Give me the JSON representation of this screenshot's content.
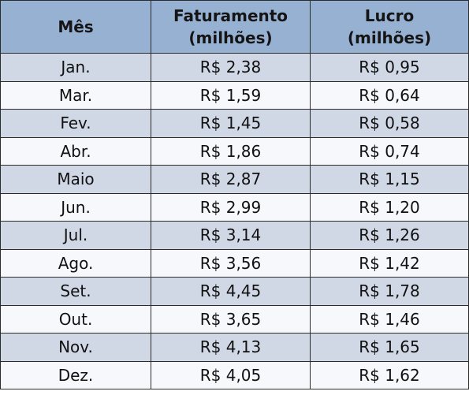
{
  "table": {
    "headers": [
      {
        "line1": "Mês",
        "line2": ""
      },
      {
        "line1": "Faturamento",
        "line2": "(milhões)"
      },
      {
        "line1": "Lucro",
        "line2": "(milhões)"
      }
    ],
    "rows": [
      [
        "Jan.",
        "R$ 2,38",
        "R$ 0,95"
      ],
      [
        "Mar.",
        "R$ 1,59",
        "R$ 0,64"
      ],
      [
        "Fev.",
        "R$ 1,45",
        "R$ 0,58"
      ],
      [
        "Abr.",
        "R$ 1,86",
        "R$ 0,74"
      ],
      [
        "Maio",
        "R$ 2,87",
        "R$ 1,15"
      ],
      [
        "Jun.",
        "R$ 2,99",
        "R$ 1,20"
      ],
      [
        "Jul.",
        "R$ 3,14",
        "R$ 1,26"
      ],
      [
        "Ago.",
        "R$ 3,56",
        "R$ 1,42"
      ],
      [
        "Set.",
        "R$ 4,45",
        "R$ 1,78"
      ],
      [
        "Out.",
        "R$ 3,65",
        "R$ 1,46"
      ],
      [
        "Nov.",
        "R$ 4,13",
        "R$ 1,65"
      ],
      [
        "Dez.",
        "R$ 4,05",
        "R$ 1,62"
      ]
    ],
    "colors": {
      "header_bg": "#97b1d3",
      "row_odd_bg": "#d0d7e5",
      "row_even_bg": "#f6f8fc",
      "border": "#2b2b2b"
    }
  }
}
